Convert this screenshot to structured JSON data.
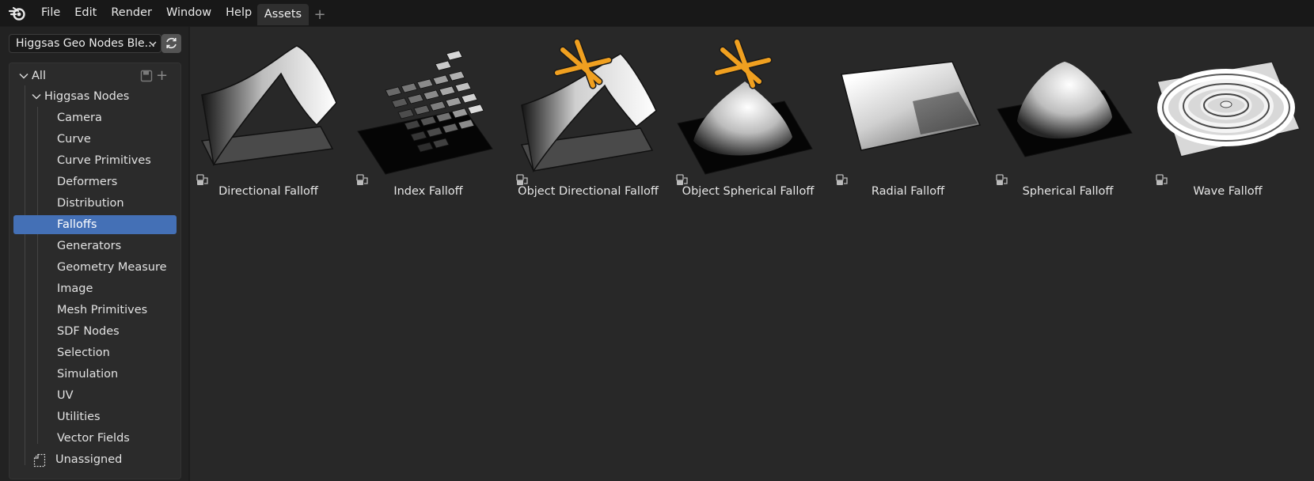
{
  "topbar": {
    "menu": [
      "File",
      "Edit",
      "Render",
      "Window",
      "Help"
    ],
    "tab_label": "Assets",
    "tab_add": "+"
  },
  "sidebar": {
    "library_selector": "Higgsas Geo Nodes Ble...",
    "tree": {
      "root": "All",
      "group": "Higgsas Nodes",
      "items": [
        "Camera",
        "Curve",
        "Curve Primitives",
        "Deformers",
        "Distribution",
        "Falloffs",
        "Generators",
        "Geometry Measure",
        "Image",
        "Mesh Primitives",
        "SDF Nodes",
        "Selection",
        "Simulation",
        "UV",
        "Utilities",
        "Vector Fields"
      ],
      "selected": "Falloffs",
      "unassigned": "Unassigned"
    }
  },
  "assets": [
    {
      "name": "Directional Falloff",
      "thumbnail": "directional-falloff-preview"
    },
    {
      "name": "Index Falloff",
      "thumbnail": "index-falloff-preview"
    },
    {
      "name": "Object Directional Falloff",
      "thumbnail": "object-directional-falloff-preview"
    },
    {
      "name": "Object Spherical Falloff",
      "thumbnail": "object-spherical-falloff-preview"
    },
    {
      "name": "Radial Falloff",
      "thumbnail": "radial-falloff-preview"
    },
    {
      "name": "Spherical Falloff",
      "thumbnail": "spherical-falloff-preview"
    },
    {
      "name": "Wave Falloff",
      "thumbnail": "wave-falloff-preview"
    }
  ],
  "colors": {
    "selection": "#4470b6",
    "empty_accent": "#f0a020"
  }
}
